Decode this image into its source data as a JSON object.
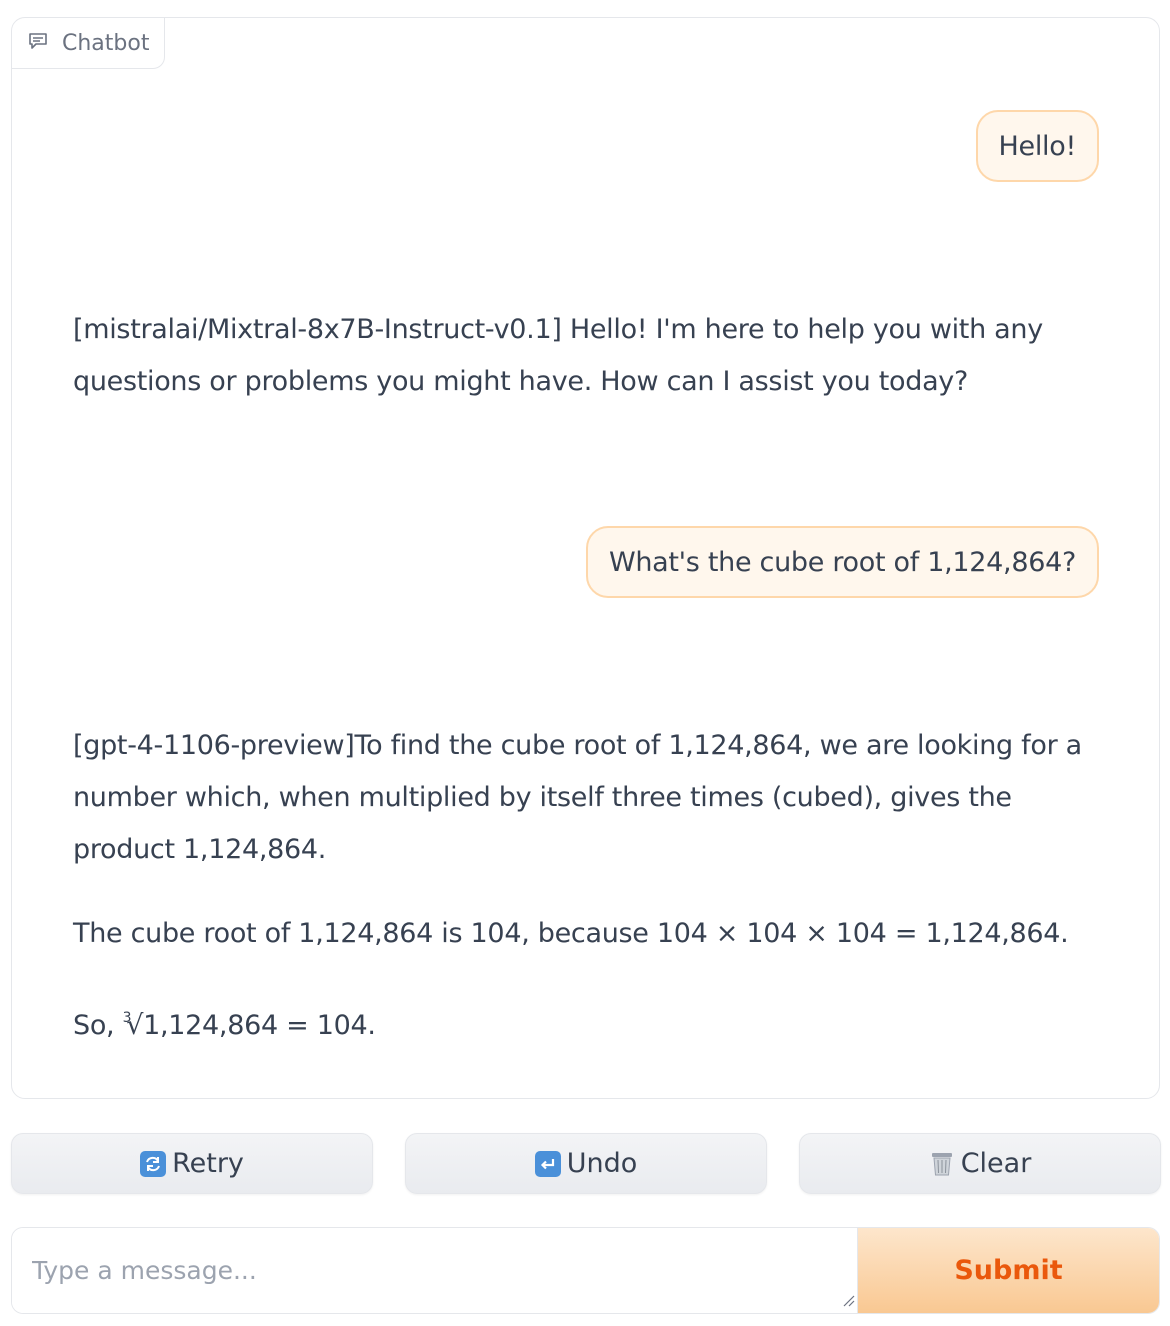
{
  "chatbot": {
    "label": "Chatbot",
    "label_icon": "chat-bubble-icon",
    "messages": [
      {
        "role": "user",
        "text": "Hello!"
      },
      {
        "role": "bot",
        "paragraphs": [
          "[mistralai/Mixtral-8x7B-Instruct-v0.1] Hello! I'm here to help you with any questions or problems you might have. How can I assist you today?"
        ]
      },
      {
        "role": "user",
        "text": "What's the cube root of 1,124,864?"
      },
      {
        "role": "bot",
        "paragraphs": [
          "[gpt-4-1106-preview]To find the cube root of 1,124,864, we are looking for a number which, when multiplied by itself three times (cubed), gives the product 1,124,864.",
          "The cube root of 1,124,864 is 104, because 104 × 104 × 104 = 1,124,864."
        ],
        "final_prefix": "So, ",
        "root_index": "3",
        "root_symbol": "√",
        "root_body": "1,124,864 = 104."
      }
    ]
  },
  "actions": {
    "retry_label": "Retry",
    "retry_icon": "arrows-counterclockwise-icon",
    "undo_label": "Undo",
    "undo_icon": "return-arrow-icon",
    "clear_label": "Clear",
    "clear_icon": "wastebasket-icon"
  },
  "input": {
    "placeholder": "Type a message...",
    "value": "",
    "submit_label": "Submit"
  },
  "colors": {
    "user_bubble_bg": "#fff7ed",
    "user_bubble_border": "#fed7aa",
    "submit_text": "#ea580c",
    "submit_bg_top": "#fde6cc",
    "submit_bg_bottom": "#f9c892"
  }
}
